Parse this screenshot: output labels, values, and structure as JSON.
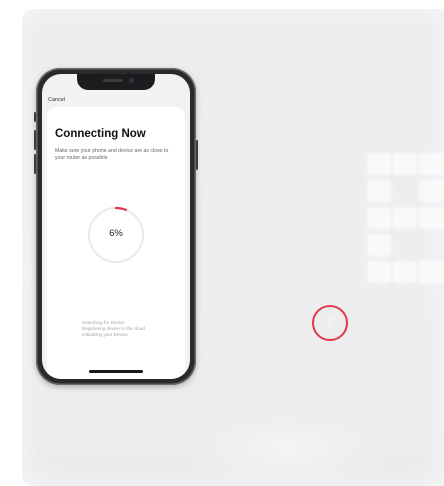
{
  "screen": {
    "cancel_label": "Cancel",
    "title": "Connecting Now",
    "subtitle": "Make sure your phone and device are as close to your router as possible.",
    "progress": {
      "percent_label": "6%",
      "value": 0.06,
      "accent": "#e8354a",
      "track": "#ebebed"
    },
    "steps": [
      "Searching for Device",
      "Registering device to the cloud",
      "Initializing your Device"
    ]
  },
  "device": {
    "wifi_indicator_icon": "wifi-icon",
    "ring_color": "#e23a4c"
  }
}
